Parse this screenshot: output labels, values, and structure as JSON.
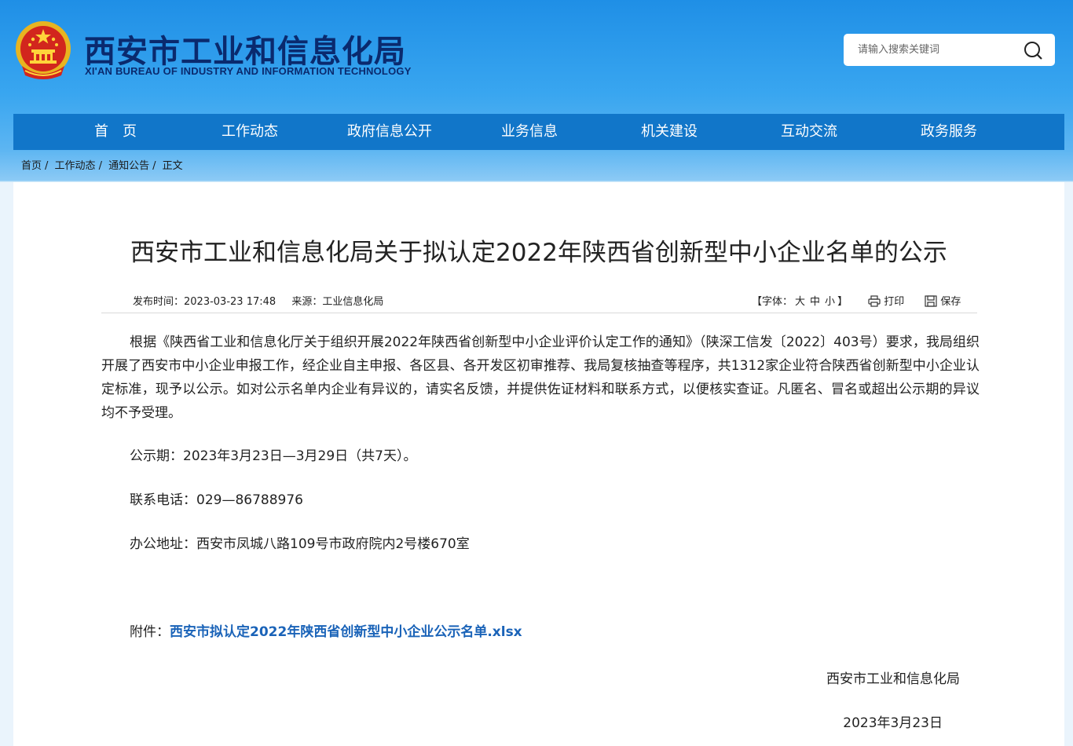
{
  "header": {
    "site_title": "西安市工业和信息化局",
    "site_subtitle": "XI'AN BUREAU OF INDUSTRY AND INFORMATION TECHNOLOGY",
    "emblem_icon": "national-emblem-icon",
    "search": {
      "placeholder": "请输入搜索关键词",
      "value": "",
      "icon": "search-icon"
    }
  },
  "nav": {
    "items": [
      {
        "label": "首　页"
      },
      {
        "label": "工作动态"
      },
      {
        "label": "政府信息公开"
      },
      {
        "label": "业务信息"
      },
      {
        "label": "机关建设"
      },
      {
        "label": "互动交流"
      },
      {
        "label": "政务服务"
      }
    ]
  },
  "breadcrumb": {
    "items": [
      "首页",
      "工作动态",
      "通知公告",
      "正文"
    ],
    "separator": "/"
  },
  "article": {
    "title": "西安市工业和信息化局关于拟认定2022年陕西省创新型中小企业名单的公示",
    "meta": {
      "publish_label": "发布时间：",
      "publish_time": "2023-03-23 17:48",
      "source_label": "来源：",
      "source": "工业信息化局",
      "font_label_open": "【字体：",
      "font_large": "大",
      "font_medium": "中",
      "font_small": "小",
      "font_label_close": "】",
      "print_label": "打印",
      "save_label": "保存"
    },
    "body": {
      "p1": "根据《陕西省工业和信息化厅关于组织开展2022年陕西省创新型中小企业评价认定工作的通知》（陕深工信发〔2022〕403号）要求，我局组织开展了西安市中小企业申报工作，经企业自主申报、各区县、各开发区初审推荐、我局复核抽查等程序，共1312家企业符合陕西省创新型中小企业认定标准，现予以公示。如对公示名单内企业有异议的，请实名反馈，并提供佐证材料和联系方式，以便核实查证。凡匿名、冒名或超出公示期的异议均不予受理。",
      "p2": "公示期：2023年3月23日—3月29日（共7天）。",
      "p3": "联系电话：029—86788976",
      "p4": "办公地址：西安市凤城八路109号市政府院内2号楼670室",
      "attachment_label": "附件：",
      "attachment_link": "西安市拟认定2022年陕西省创新型中小企业公示名单.xlsx",
      "signature": "西安市工业和信息化局",
      "date": "2023年3月23日"
    }
  },
  "colors": {
    "nav_bg": "#1176c9",
    "title_blue": "#0a2a6e",
    "link_blue": "#1a63b8",
    "header_sky": "#2a97e8"
  }
}
